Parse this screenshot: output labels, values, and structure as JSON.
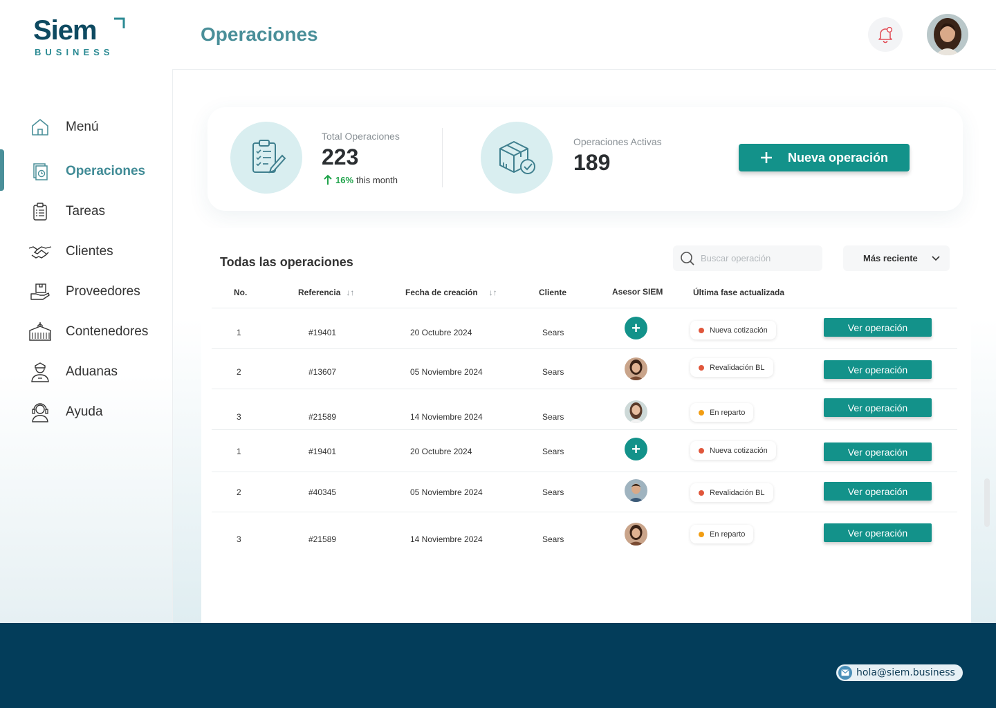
{
  "brand": {
    "name": "Siem",
    "sub": "BUSINESS"
  },
  "header": {
    "title": "Operaciones"
  },
  "sidebar": {
    "items": [
      {
        "label": "Menú",
        "icon": "home-icon"
      },
      {
        "label": "Operaciones",
        "icon": "operations-icon",
        "active": true
      },
      {
        "label": "Tareas",
        "icon": "clipboard-icon"
      },
      {
        "label": "Clientes",
        "icon": "handshake-icon"
      },
      {
        "label": "Proveedores",
        "icon": "supplier-icon"
      },
      {
        "label": "Contenedores",
        "icon": "container-icon"
      },
      {
        "label": "Aduanas",
        "icon": "customs-officer-icon"
      },
      {
        "label": "Ayuda",
        "icon": "support-icon"
      }
    ]
  },
  "stats": {
    "total_label": "Total Operaciones",
    "total_value": "223",
    "trend_pct": "16%",
    "trend_text": "this month",
    "active_label": "Operaciones Activas",
    "active_value": "189",
    "new_button": "Nueva operación"
  },
  "table": {
    "title": "Todas las operaciones",
    "search_placeholder": "Buscar operación",
    "sort_label": "Más reciente",
    "columns": [
      "No.",
      "Referencia",
      "Fecha de creación",
      "Cliente",
      "Asesor SIEM",
      "Última fase actualizada"
    ],
    "action_label": "Ver operación",
    "rows": [
      {
        "no": "1",
        "ref": "#19401",
        "date": "20 Octubre 2024",
        "client": "Sears",
        "asesor": "add",
        "phase": "Nueva cotización",
        "phase_color": "#e0563b"
      },
      {
        "no": "2",
        "ref": "#13607",
        "date": "05 Noviembre 2024",
        "client": "Sears",
        "asesor": "woman-1",
        "phase": "Revalidación BL",
        "phase_color": "#e0563b"
      },
      {
        "no": "3",
        "ref": "#21589",
        "date": "14 Noviembre 2024",
        "client": "Sears",
        "asesor": "woman-2",
        "phase": "En reparto",
        "phase_color": "#f29d12"
      },
      {
        "no": "1",
        "ref": "#19401",
        "date": "20 Octubre 2024",
        "client": "Sears",
        "asesor": "add",
        "phase": "Nueva cotización",
        "phase_color": "#e0563b"
      },
      {
        "no": "2",
        "ref": "#40345",
        "date": "05 Noviembre 2024",
        "client": "Sears",
        "asesor": "man-1",
        "phase": "Revalidación BL",
        "phase_color": "#e0563b"
      },
      {
        "no": "3",
        "ref": "#21589",
        "date": "14 Noviembre 2024",
        "client": "Sears",
        "asesor": "woman-1",
        "phase": "En reparto",
        "phase_color": "#f29d12"
      }
    ]
  },
  "footer": {
    "email": "hola@siem.business"
  },
  "colors": {
    "primary": "#13928a",
    "accent": "#4a8f99",
    "navy": "#033d5a"
  }
}
